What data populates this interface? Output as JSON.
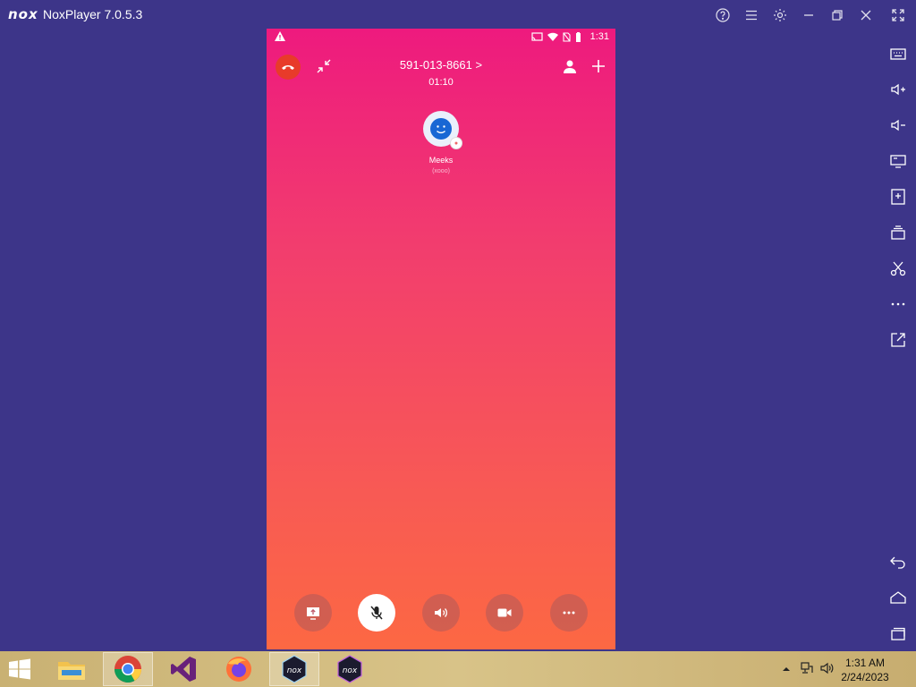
{
  "window": {
    "logo_text": "nox",
    "title": "NoxPlayer 7.0.5.3"
  },
  "title_buttons": [
    "help-icon",
    "menu-icon",
    "settings-icon",
    "minimize-icon",
    "restore-icon",
    "close-icon",
    "fullscreen-icon"
  ],
  "sidebar": [
    "keyboard-icon",
    "volume-up-icon",
    "volume-down-icon",
    "screen-icon",
    "apk-install-icon",
    "multi-instance-icon",
    "screenshot-icon",
    "more-icon",
    "export-icon",
    "back-icon",
    "home-icon",
    "recent-apps-icon"
  ],
  "status_bar": {
    "time": "1:31"
  },
  "call": {
    "phone_number": "591-013-8661",
    "chevron": ">",
    "timer": "01:10",
    "contact_name": "Meeks",
    "contact_sub": "(xooo)"
  },
  "call_controls": [
    {
      "name": "screen-share-button",
      "icon": "screen-share-icon",
      "active": false
    },
    {
      "name": "mute-button",
      "icon": "mic-off-icon",
      "active": true
    },
    {
      "name": "speaker-button",
      "icon": "speaker-icon",
      "active": false
    },
    {
      "name": "video-button",
      "icon": "video-camera-icon",
      "active": false
    },
    {
      "name": "more-options-button",
      "icon": "more-dots-icon",
      "active": false
    }
  ],
  "taskbar": {
    "apps": [
      "file-explorer",
      "chrome",
      "visual-studio",
      "firefox",
      "noxplayer",
      "nox-multi-drive"
    ],
    "active_app": "noxplayer",
    "time": "1:31 AM",
    "date": "2/24/2023"
  },
  "colors": {
    "desktop_bg": "#3d3589",
    "gradient_top": "#ee1a7e",
    "gradient_bottom": "#fc6843",
    "end_call": "#e83b2a"
  }
}
